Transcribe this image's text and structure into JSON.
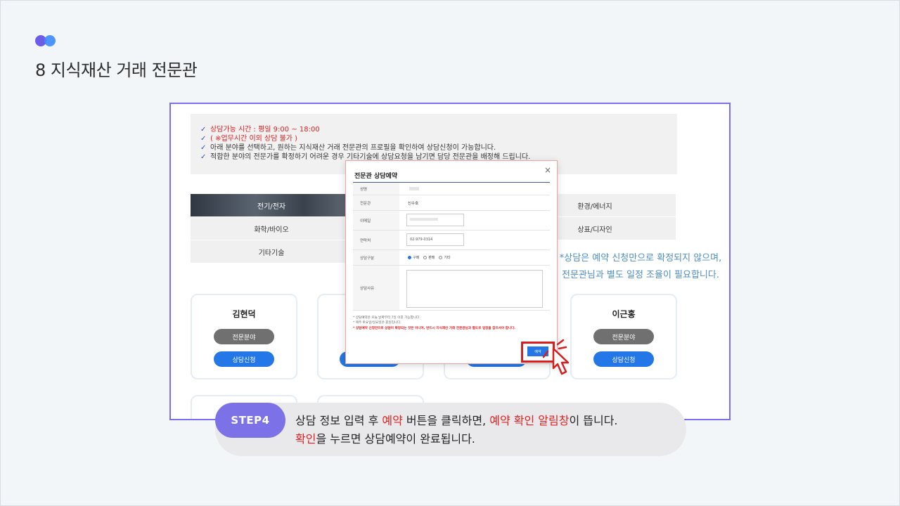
{
  "header": {
    "title": "8 지식재산 거래 전문관"
  },
  "notice": {
    "lines": [
      "상담가능 시간 : 평일 9:00 ~ 18:00",
      "( ※업무시간 이외 상담 불가 )",
      "아래 분야를 선택하고, 원하는 지식재산 거래 전문관의 프로필을 확인하여 상담신청이 가능합니다.",
      "적합한 분야의 전문가를 확정하기 어려운 경우 기타기술에 상담요청을 남기면 담당 전문관을 배정해 드립니다."
    ]
  },
  "categories": [
    "전기/전자",
    "환경/에너지",
    "화학/바이오",
    "상표/디자인",
    "기타기술"
  ],
  "side_note": {
    "line1": "*상담은 예약 신청만으로 확정되지 않으며,",
    "line2": "전문관님과 별도 일정 조율이 필요합니다."
  },
  "cards": [
    {
      "name": "김현덕",
      "field_btn": "전문분야",
      "apply_btn": "상담신청"
    },
    {
      "name": "이근홍",
      "field_btn": "전문분야",
      "apply_btn": "상담신청"
    }
  ],
  "modal": {
    "title": "전문관 상담예약",
    "close": "×",
    "labels": {
      "name": "성명",
      "expert": "전문관",
      "email": "이메일",
      "phone": "연락처",
      "type": "상담구분",
      "reason": "상담사유"
    },
    "expert_value": "신수호",
    "phone_value": "02-979-0314",
    "radio": [
      "구매",
      "판매",
      "기타"
    ],
    "notes": [
      "* 상담예약은 오늘 날짜부터 7일 이후 가능합니다.",
      "* 매주 토요일/일요일은 휴일입니다."
    ],
    "note_red": "* 상담예약 신청만으로 상담이 확정되는 것은 아니며, 반드시 지식재산 거래 전문관님과 별도로 일정을 잡으셔야 합니다.",
    "submit": "예약"
  },
  "step": {
    "badge": "STEP4",
    "l1_a": "상담 정보 입력 후 ",
    "l1_red1": "예약",
    "l1_b": " 버튼을 클릭하면, ",
    "l1_red2": "예약 확인 알림창",
    "l1_c": "이 뜹니다.",
    "l2_red": "확인",
    "l2_a": "을 누르면 상담예약이 완료됩니다."
  }
}
